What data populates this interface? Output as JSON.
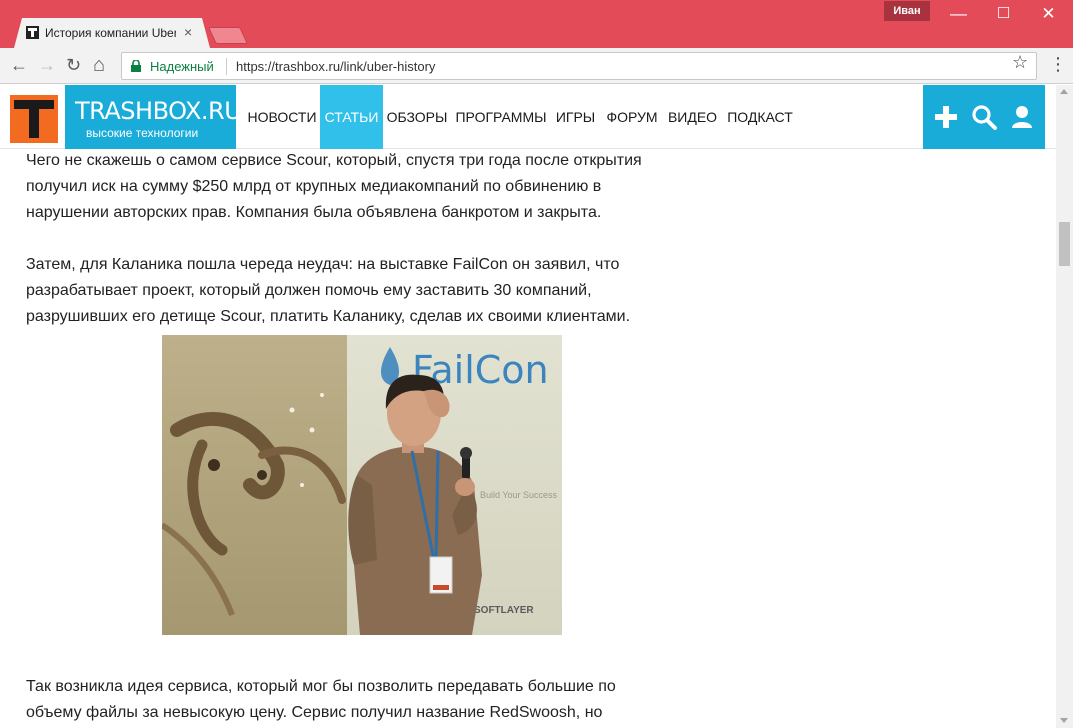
{
  "browser": {
    "tab_title": "История компании Uber",
    "tab_close": "×",
    "profile_name": "Иван",
    "window_min": "—",
    "window_max": "☐",
    "window_close": "✕",
    "nav_back": "←",
    "nav_forward": "→",
    "nav_reload": "↻",
    "nav_home": "⌂",
    "secure_label": "Надежный",
    "url": "https://trashbox.ru/link/uber-history",
    "bookmark_star": "☆",
    "menu": "⋮"
  },
  "site": {
    "logo_name": "TRASHBOX.RU",
    "logo_tagline": "высокие технологии",
    "nav": [
      "Новости",
      "Статьи",
      "Обзоры",
      "Программы",
      "Игры",
      "Форум",
      "Видео",
      "Подкаст"
    ],
    "active_nav": "Статьи",
    "colors": {
      "brand": "#1aacd8",
      "active": "#30c0ea",
      "logo_orange": "#f36b21"
    },
    "icons": [
      "plus-icon",
      "search-icon",
      "user-icon"
    ]
  },
  "article": {
    "p1": [
      "Чего не скажешь о самом сервисе Scour, который, спустя три года после открытия",
      "получил иск на сумму $250 млрд от крупных медиакомпаний по обвинению в",
      "нарушении авторских прав. Компания была объявлена банкротом и закрыта."
    ],
    "p2": [
      "Затем, для Каланика пошла череда неудач: на выставке FailCon он заявил, что",
      "разрабатывает проект, который должен помочь ему заставить 30 компаний,",
      "разрушивших его детище Scour, платить Каланику, сделав их своими клиентами."
    ],
    "photo_banner": "FailCon",
    "photo_tagline": "Build Your Success",
    "photo_sponsor": "SOFTLAYER",
    "p3": [
      "Так возникла идея сервиса, который мог бы позволить передавать большие по",
      "объему файлы за невысокую цену. Сервис получил название RedSwoosh, но"
    ]
  }
}
